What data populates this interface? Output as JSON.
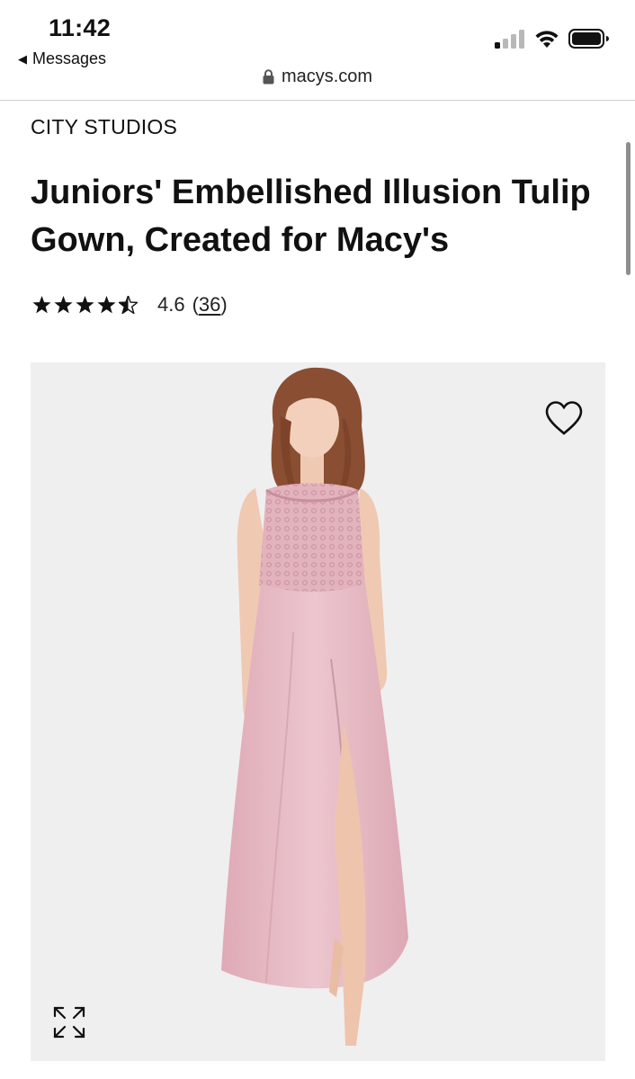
{
  "status_bar": {
    "time": "11:42",
    "back_label": "Messages",
    "icons": [
      "cellular-signal-icon",
      "wifi-icon",
      "battery-icon"
    ]
  },
  "browser": {
    "url": "macys.com",
    "icon": "lock-icon"
  },
  "product": {
    "brand": "CITY STUDIOS",
    "title": "Juniors' Embellished Illusion Tulip Gown, Created for Macy's",
    "rating": {
      "stars": 4.6,
      "value_text": "4.6",
      "open_paren": "(",
      "review_count": "36",
      "close_paren": ")"
    },
    "image": {
      "icons": [
        "heart-icon",
        "expand-icon"
      ],
      "dress_color": "#e9bfc8"
    }
  },
  "colors": {
    "text": "#111111",
    "image_bg": "#efeff0"
  }
}
